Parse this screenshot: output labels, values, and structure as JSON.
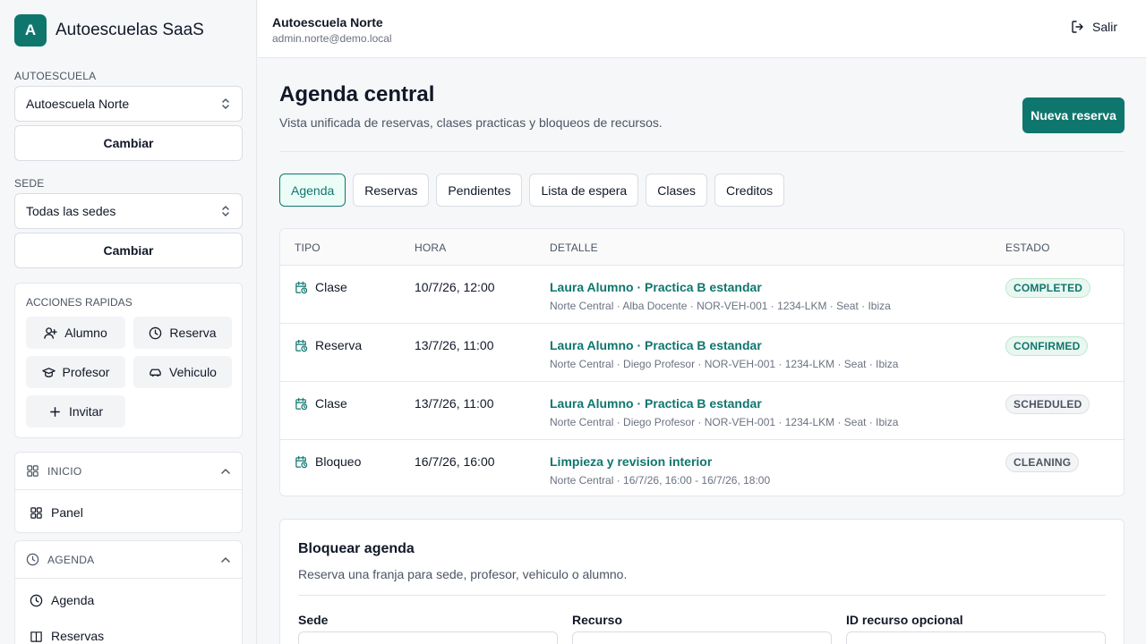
{
  "brand": {
    "logo_letter": "A",
    "name": "Autoescuelas SaaS"
  },
  "sidebar": {
    "school_label": "AUTOESCUELA",
    "school_value": "Autoescuela Norte",
    "school_change": "Cambiar",
    "site_label": "SEDE",
    "site_value": "Todas las sedes",
    "site_change": "Cambiar",
    "quick_actions": {
      "title": "ACCIONES RAPIDAS",
      "student": "Alumno",
      "booking": "Reserva",
      "teacher": "Profesor",
      "vehicle": "Vehiculo",
      "invite": "Invitar"
    },
    "sections": [
      {
        "title": "INICIO",
        "items": [
          "Panel"
        ]
      },
      {
        "title": "AGENDA",
        "items": [
          "Agenda",
          "Reservas"
        ]
      }
    ]
  },
  "topbar": {
    "school": "Autoescuela Norte",
    "email": "admin.norte@demo.local",
    "logout": "Salir"
  },
  "main": {
    "title": "Agenda central",
    "subtitle": "Vista unificada de reservas, clases practicas y bloqueos de recursos.",
    "new_button": "Nueva reserva",
    "tabs": [
      "Agenda",
      "Reservas",
      "Pendientes",
      "Lista de espera",
      "Clases",
      "Creditos"
    ],
    "active_tab": "Agenda"
  },
  "table": {
    "headers": [
      "TIPO",
      "HORA",
      "DETALLE",
      "ESTADO"
    ],
    "rows": [
      {
        "type": "Clase",
        "time": "10/7/26, 12:00",
        "title": "Laura Alumno · Practica B estandar",
        "meta": "Norte Central · Alba Docente · NOR-VEH-001 · 1234-LKM · Seat · Ibiza",
        "status": "COMPLETED",
        "status_color": "green"
      },
      {
        "type": "Reserva",
        "time": "13/7/26, 11:00",
        "title": "Laura Alumno · Practica B estandar",
        "meta": "Norte Central · Diego Profesor · NOR-VEH-001 · 1234-LKM · Seat · Ibiza",
        "status": "CONFIRMED",
        "status_color": "green"
      },
      {
        "type": "Clase",
        "time": "13/7/26, 11:00",
        "title": "Laura Alumno · Practica B estandar",
        "meta": "Norte Central · Diego Profesor · NOR-VEH-001 · 1234-LKM · Seat · Ibiza",
        "status": "SCHEDULED",
        "status_color": "gray"
      },
      {
        "type": "Bloqueo",
        "time": "16/7/26, 16:00",
        "title": "Limpieza y revision interior",
        "meta": "Norte Central · 16/7/26, 16:00 - 16/7/26, 18:00",
        "status": "CLEANING",
        "status_color": "gray"
      }
    ]
  },
  "block_form": {
    "title": "Bloquear agenda",
    "subtitle": "Reserva una franja para sede, profesor, vehiculo o alumno.",
    "field_site": "Sede",
    "field_resource": "Recurso",
    "field_resource_id": "ID recurso opcional"
  },
  "colors": {
    "accent": "#0f766e",
    "badge_green_bg": "#e8f7ef",
    "badge_gray_bg": "#f3f4f6"
  }
}
